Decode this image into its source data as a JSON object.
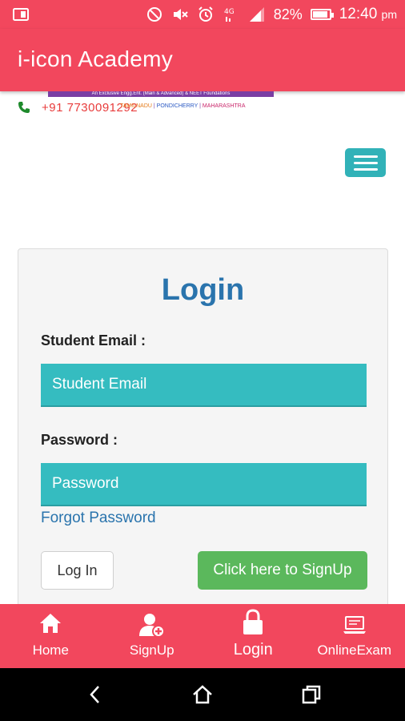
{
  "status_bar": {
    "battery_percent": "82%",
    "time": "12:40",
    "time_suffix": "pm",
    "icons": [
      "cast-icon",
      "do-not-disturb-icon",
      "mute-icon",
      "alarm-icon",
      "4g-icon",
      "signal-icon",
      "battery-icon"
    ]
  },
  "app_bar": {
    "title": "i-icon Academy"
  },
  "banner": {
    "tagline": "An Exclusive Engg.Ent. (Main & Advanced) & NEET Foundations",
    "phone": "+91 7730091292",
    "places": {
      "a": "TAMILNADU",
      "b": "PONDICHERRY",
      "c": "MAHARASHTRA"
    }
  },
  "login": {
    "heading": "Login",
    "email_label": "Student Email :",
    "email_placeholder": "Student Email",
    "password_label": "Password :",
    "password_placeholder": "Password",
    "forgot_link": "Forgot Password",
    "login_button": "Log In",
    "signup_button": "Click here to SignUp"
  },
  "bottom_nav": {
    "items": [
      {
        "label": "Home",
        "icon": "home-icon"
      },
      {
        "label": "SignUp",
        "icon": "add-user-icon"
      },
      {
        "label": "Login",
        "icon": "lock-icon",
        "active": true
      },
      {
        "label": "OnlineExam",
        "icon": "laptop-icon"
      }
    ]
  },
  "colors": {
    "primary": "#f2475d",
    "teal": "#35bcc0",
    "link_blue": "#2a74ad",
    "signup_green": "#5bb85c"
  }
}
